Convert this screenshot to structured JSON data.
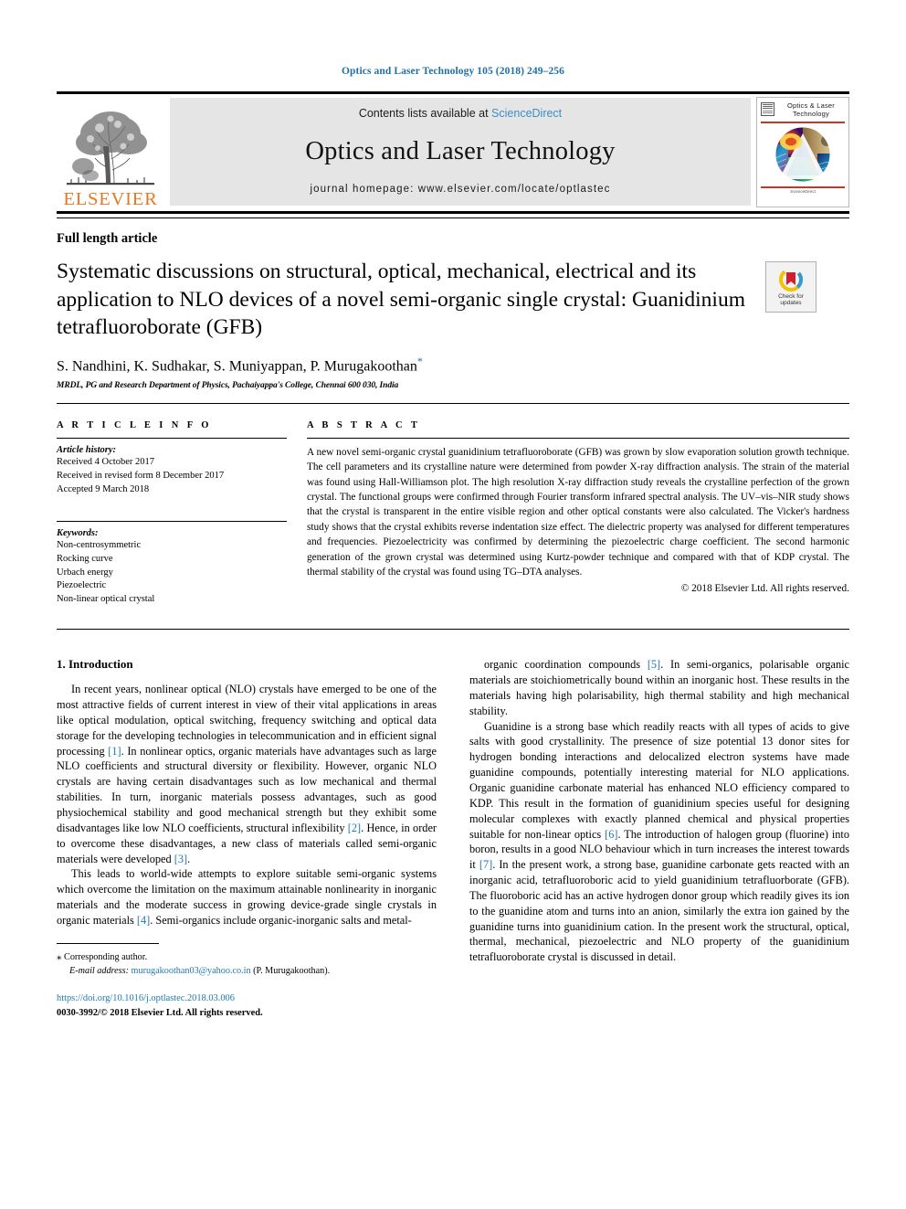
{
  "running_head": "Optics and Laser Technology 105 (2018) 249–256",
  "masthead": {
    "publisher_name": "ELSEVIER",
    "contents_prefix": "Contents lists available at",
    "sciencedirect": "ScienceDirect",
    "journal_title": "Optics and Laser Technology",
    "homepage": "journal homepage: www.elsevier.com/locate/optlastec",
    "cover": {
      "title": "Optics & Laser Technology",
      "footer": "ScienceDirect"
    }
  },
  "article": {
    "type": "Full length article",
    "title": "Systematic discussions on structural, optical, mechanical, electrical and its application to NLO devices of a novel semi-organic single crystal: Guanidinium tetrafluoroborate (GFB)",
    "authors": "S. Nandhini, K. Sudhakar, S. Muniyappan, P. Murugakoothan",
    "corresponding_marker": "*",
    "affiliation": "MRDL, PG and Research Department of Physics, Pachaiyappa's College, Chennai 600 030, India",
    "crossmark_label_line1": "Check for",
    "crossmark_label_line2": "updates"
  },
  "info": {
    "heading": "A R T I C L E   I N F O",
    "history_label": "Article history:",
    "history": [
      "Received 4 October 2017",
      "Received in revised form 8 December 2017",
      "Accepted 9 March 2018"
    ],
    "keywords_label": "Keywords:",
    "keywords": [
      "Non-centrosymmetric",
      "Rocking curve",
      "Urbach energy",
      "Piezoelectric",
      "Non-linear optical crystal"
    ]
  },
  "abstract": {
    "heading": "A B S T R A C T",
    "text": "A new novel semi-organic crystal guanidinium tetrafluoroborate (GFB) was grown by slow evaporation solution growth technique. The cell parameters and its crystalline nature were determined from powder X-ray diffraction analysis. The strain of the material was found using Hall-Williamson plot. The high resolution X-ray diffraction study reveals the crystalline perfection of the grown crystal. The functional groups were confirmed through Fourier transform infrared spectral analysis. The UV–vis–NIR study shows that the crystal is transparent in the entire visible region and other optical constants were also calculated. The Vicker's hardness study shows that the crystal exhibits reverse indentation size effect. The dielectric property was analysed for different temperatures and frequencies. Piezoelectricity was confirmed by determining the piezoelectric charge coefficient. The second harmonic generation of the grown crystal was determined using Kurtz-powder technique and compared with that of KDP crystal. The thermal stability of the crystal was found using TG–DTA analyses.",
    "copyright": "© 2018 Elsevier Ltd. All rights reserved."
  },
  "body": {
    "section_title": "1. Introduction",
    "left_paragraphs": [
      "In recent years, nonlinear optical (NLO) crystals have emerged to be one of the most attractive fields of current interest in view of their vital applications in areas like optical modulation, optical switching, frequency switching and optical data storage for the developing technologies in telecommunication and in efficient signal processing [1]. In nonlinear optics, organic materials have advantages such as large NLO coefficients and structural diversity or flexibility. However, organic NLO crystals are having certain disadvantages such as low mechanical and thermal stabilities. In turn, inorganic materials possess advantages, such as good physiochemical stability and good mechanical strength but they exhibit some disadvantages like low NLO coefficients, structural inflexibility [2]. Hence, in order to overcome these disadvantages, a new class of materials called semi-organic materials were developed [3].",
      "This leads to world-wide attempts to explore suitable semi-organic systems which overcome the limitation on the maximum attainable nonlinearity in inorganic materials and the moderate success in growing device-grade single crystals in organic materials [4]. Semi-organics include organic-inorganic salts and metal-"
    ],
    "right_paragraphs": [
      "organic coordination compounds [5]. In semi-organics, polarisable organic materials are stoichiometrically bound within an inorganic host. These results in the materials having high polarisability, high thermal stability and high mechanical stability.",
      "Guanidine is a strong base which readily reacts with all types of acids to give salts with good crystallinity. The presence of size potential 13 donor sites for hydrogen bonding interactions and delocalized electron systems have made guanidine compounds, potentially interesting material for NLO applications. Organic guanidine carbonate material has enhanced NLO efficiency compared to KDP. This result in the formation of guanidinium species useful for designing molecular complexes with exactly planned chemical and physical properties suitable for non-linear optics [6]. The introduction of halogen group (fluorine) into boron, results in a good NLO behaviour which in turn increases the interest towards it [7]. In the present work, a strong base, guanidine carbonate gets reacted with an inorganic acid, tetrafluoroboric acid to yield guanidinium tetrafluorborate (GFB). The fluoroboric acid has an active hydrogen donor group which readily gives its ion to the guanidine atom and turns into an anion, similarly the extra ion gained by the guanidine turns into guanidinium cation. In the present work the structural, optical, thermal, mechanical, piezoelectric and NLO property of the guanidinium tetrafluoroborate crystal is discussed in detail."
    ]
  },
  "footnote": {
    "corresponding_star": "⁎",
    "corresponding_text": "Corresponding author.",
    "email_label": "E-mail address:",
    "email": "murugakoothan03@yahoo.co.in",
    "email_suffix": "(P. Murugakoothan).",
    "doi": "https://doi.org/10.1016/j.optlastec.2018.03.006",
    "issn": "0030-3992/© 2018 Elsevier Ltd. All rights reserved."
  },
  "colors": {
    "link": "#1f7aab",
    "header_blue": "#1f6fa8",
    "elsevier_orange": "#e87722",
    "banner_gray": "#e5e5e5"
  }
}
